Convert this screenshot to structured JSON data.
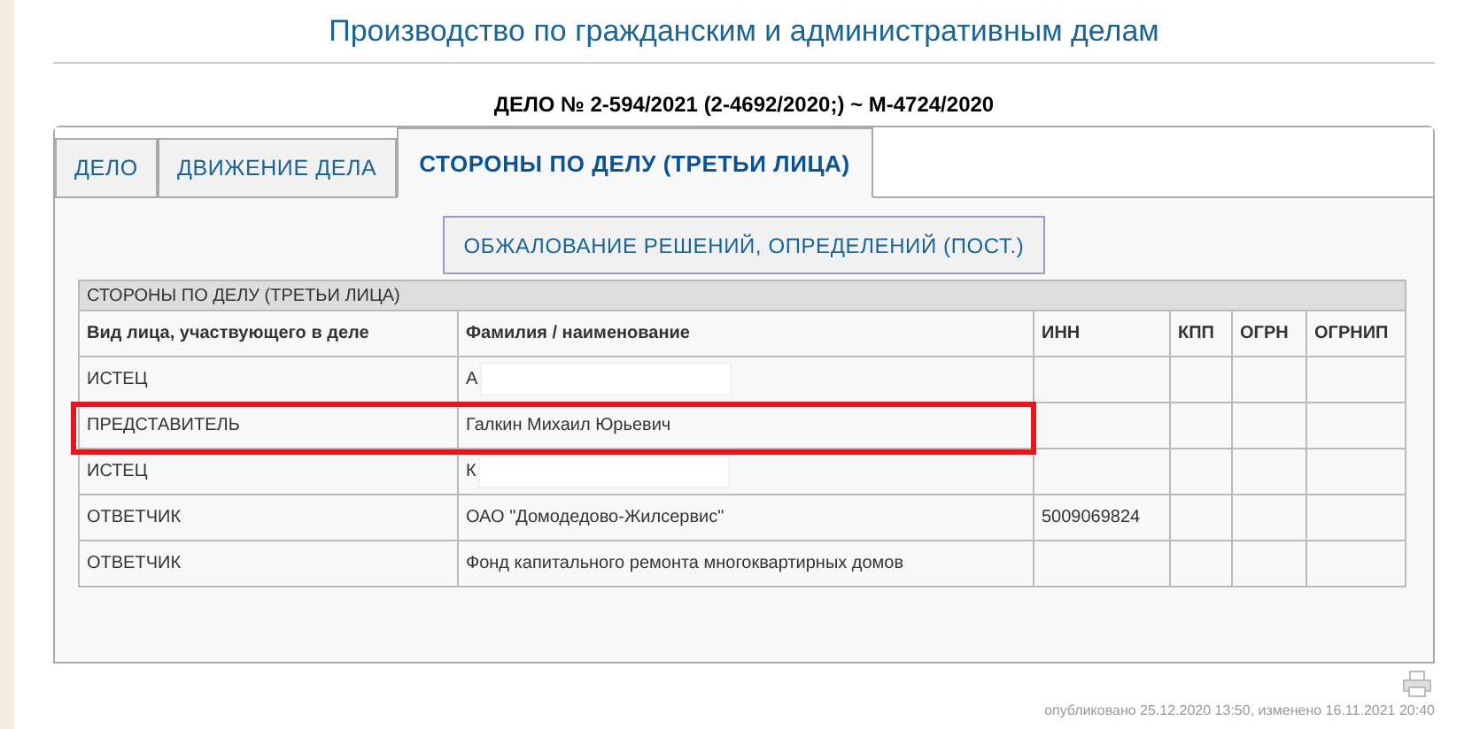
{
  "page_title": "Производство по гражданским и административным делам",
  "case_heading": "ДЕЛО № 2-594/2021 (2-4692/2020;) ~ М-4724/2020",
  "tabs": [
    {
      "label": "ДЕЛО",
      "selected": false
    },
    {
      "label": "ДВИЖЕНИЕ ДЕЛА",
      "selected": false
    },
    {
      "label": "СТОРОНЫ ПО ДЕЛУ (ТРЕТЬИ ЛИЦА)",
      "selected": true
    }
  ],
  "sub_tab": {
    "label": "ОБЖАЛОВАНИЕ РЕШЕНИЙ, ОПРЕДЕЛЕНИЙ (ПОСТ.)"
  },
  "table": {
    "caption": "СТОРОНЫ ПО ДЕЛУ (ТРЕТЬИ ЛИЦА)",
    "columns": [
      "Вид лица, участвующего в деле",
      "Фамилия / наименование",
      "ИНН",
      "КПП",
      "ОГРН",
      "ОГРНИП"
    ],
    "rows": [
      {
        "cells": [
          "ИСТЕЦ",
          "А",
          "",
          "",
          "",
          ""
        ],
        "redacted": true,
        "highlighted": false
      },
      {
        "cells": [
          "ПРЕДСТАВИТЕЛЬ",
          "Галкин Михаил Юрьевич",
          "",
          "",
          "",
          ""
        ],
        "redacted": false,
        "highlighted": true
      },
      {
        "cells": [
          "ИСТЕЦ",
          "К",
          "",
          "",
          "",
          ""
        ],
        "redacted": true,
        "highlighted": false
      },
      {
        "cells": [
          "ОТВЕТЧИК",
          "ОАО \"Домодедово-Жилсервис\"",
          "5009069824",
          "",
          "",
          ""
        ],
        "redacted": false,
        "highlighted": false
      },
      {
        "cells": [
          "ОТВЕТЧИК",
          "Фонд капитального ремонта многоквартирных домов",
          "",
          "",
          "",
          ""
        ],
        "redacted": false,
        "highlighted": false
      }
    ]
  },
  "footer": "опубликовано 25.12.2020 13:50, изменено 16.11.2021 20:40"
}
